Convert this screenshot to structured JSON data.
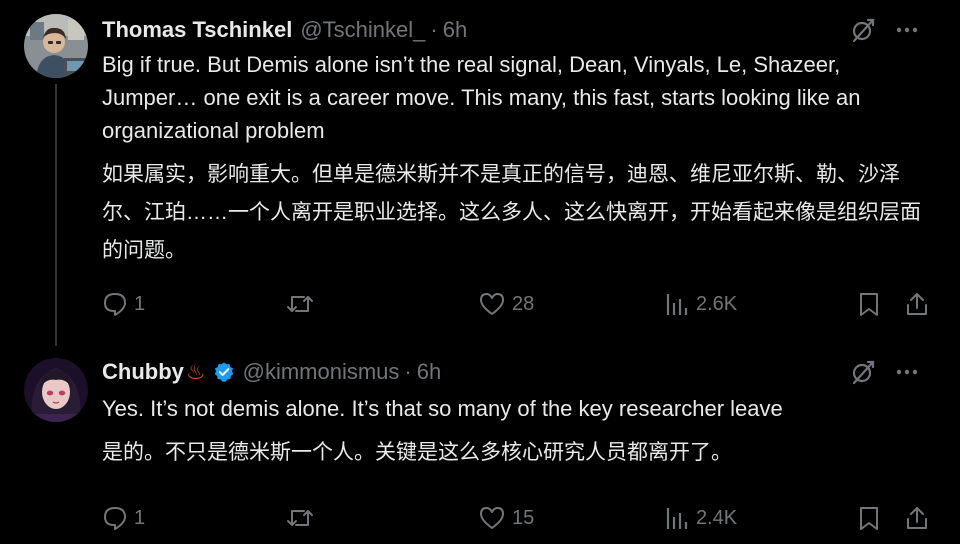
{
  "tweets": [
    {
      "display_name": "Thomas Tschinkel",
      "handle": "@Tschinkel_",
      "separator": "·",
      "time": "6h",
      "text_en": "Big if true. But Demis alone isn’t the real signal, Dean, Vinyals, Le, Shazeer, Jumper… one exit is a career move. This many, this fast, starts looking like an organizational problem",
      "text_zh": "如果属实，影响重大。但单是德米斯并不是真正的信号，迪恩、维尼亚尔斯、勒、沙泽尔、江珀……一个人离开是职业选择。这么多人、这么快离开，开始看起来像是组织层面的问题。",
      "replies": "1",
      "retweets": "",
      "likes": "28",
      "views": "2.6K",
      "avatar_icon": "avatar-man-at-desk"
    },
    {
      "display_name": "Chubby",
      "name_emoji": "♨",
      "verified": true,
      "handle": "@kimmonismus",
      "separator": "·",
      "time": "6h",
      "text_en": "Yes. It’s not demis alone. It’s that so many of the key researcher leave",
      "text_zh": "是的。不只是德米斯一个人。关键是这么多核心研究人员都离开了。",
      "replies": "1",
      "retweets": "",
      "likes": "15",
      "views": "2.4K",
      "avatar_icon": "avatar-anime-girl"
    }
  ],
  "icons": {
    "header_action": "grok-slash-icon",
    "more": "more-icon",
    "reply": "reply-icon",
    "retweet": "retweet-icon",
    "like": "heart-icon",
    "views": "views-icon",
    "bookmark": "bookmark-icon",
    "share": "share-icon",
    "verified": "verified-badge-icon"
  },
  "colors": {
    "background": "#000000",
    "text": "#e7e9ea",
    "secondary": "#71767b",
    "verified": "#1d9bf0",
    "thread_line": "#333639"
  }
}
